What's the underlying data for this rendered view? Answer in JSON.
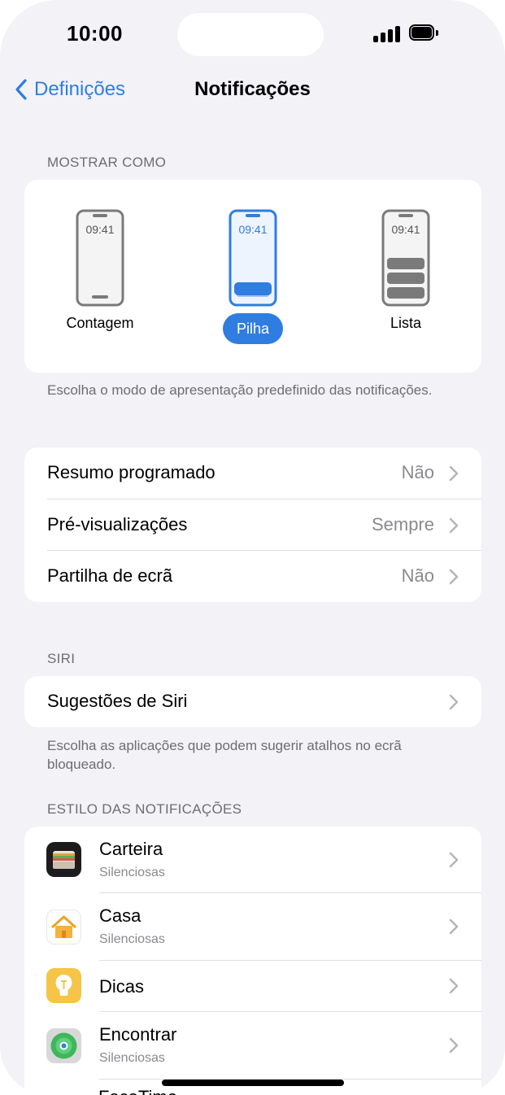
{
  "status": {
    "time": "10:00"
  },
  "nav": {
    "back_label": "Definições",
    "title": "Notificações"
  },
  "display_as": {
    "header": "MOSTRAR COMO",
    "clock": "09:41",
    "options": [
      "Contagem",
      "Pilha",
      "Lista"
    ],
    "selected": "Pilha",
    "footer": "Escolha o modo de apresentação predefinido das notificações."
  },
  "settings": [
    {
      "title": "Resumo programado",
      "value": "Não"
    },
    {
      "title": "Pré-visualizações",
      "value": "Sempre"
    },
    {
      "title": "Partilha de ecrã",
      "value": "Não"
    }
  ],
  "siri": {
    "header": "SIRI",
    "row_title": "Sugestões de Siri",
    "footer": "Escolha as aplicações que podem sugerir atalhos no ecrã bloqueado."
  },
  "style": {
    "header": "ESTILO DAS NOTIFICAÇÕES",
    "apps": [
      {
        "name": "Carteira",
        "subtitle": "Silenciosas",
        "icon": "wallet-icon"
      },
      {
        "name": "Casa",
        "subtitle": "Silenciosas",
        "icon": "home-icon"
      },
      {
        "name": "Dicas",
        "subtitle": "",
        "icon": "tips-icon"
      },
      {
        "name": "Encontrar",
        "subtitle": "Silenciosas",
        "icon": "find-my-icon"
      }
    ],
    "next_app_partial": "FaceTime"
  },
  "colors": {
    "accent": "#2f7de1",
    "background": "#f2f2f7",
    "secondary_text": "#6d6d72"
  }
}
